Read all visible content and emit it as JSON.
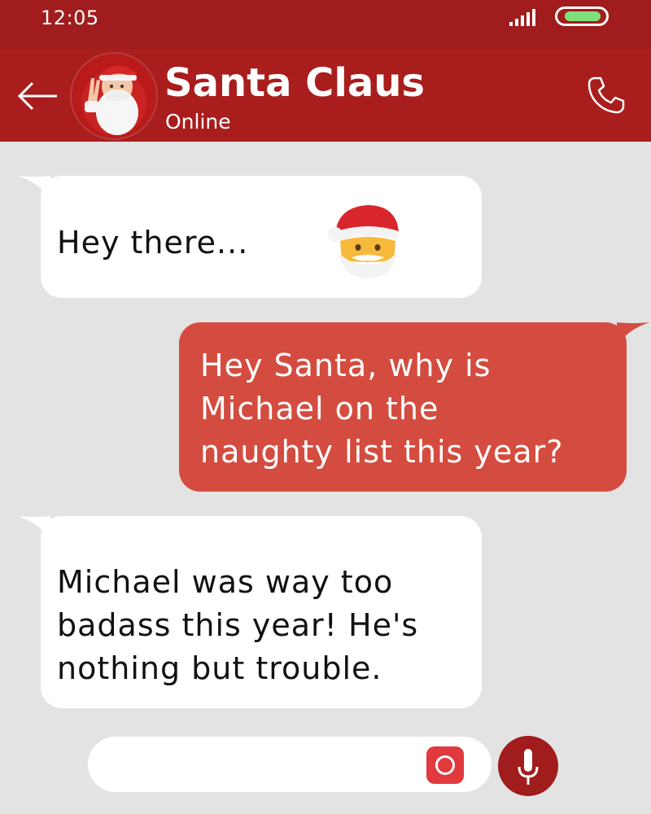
{
  "status_bar": {
    "time": "12:05",
    "signal_icon": "signal-bars-icon",
    "battery_icon": "battery-icon",
    "battery_color": "#7ee07a"
  },
  "header": {
    "back_icon": "back-arrow-icon",
    "contact_name": "Santa Claus",
    "contact_status": "Online",
    "call_icon": "phone-icon",
    "background_color": "#a91d1d"
  },
  "messages": [
    {
      "direction": "incoming",
      "lines": [
        "Hey there..."
      ],
      "emoji": "santa-face-emoji"
    },
    {
      "direction": "outgoing",
      "lines": [
        "Hey Santa, why is",
        "Michael on the",
        "naughty list this year?"
      ]
    },
    {
      "direction": "incoming",
      "lines": [
        "Michael was way too",
        "badass this year! He's",
        "nothing but trouble."
      ]
    }
  ],
  "composer": {
    "input_value": "",
    "camera_icon": "camera-icon",
    "mic_icon": "microphone-icon"
  },
  "colors": {
    "header": "#a91d1d",
    "outgoing_bubble": "#d44c3f",
    "incoming_bubble": "#ffffff",
    "background": "#e3e3e3",
    "camera_button": "#e0393e"
  }
}
